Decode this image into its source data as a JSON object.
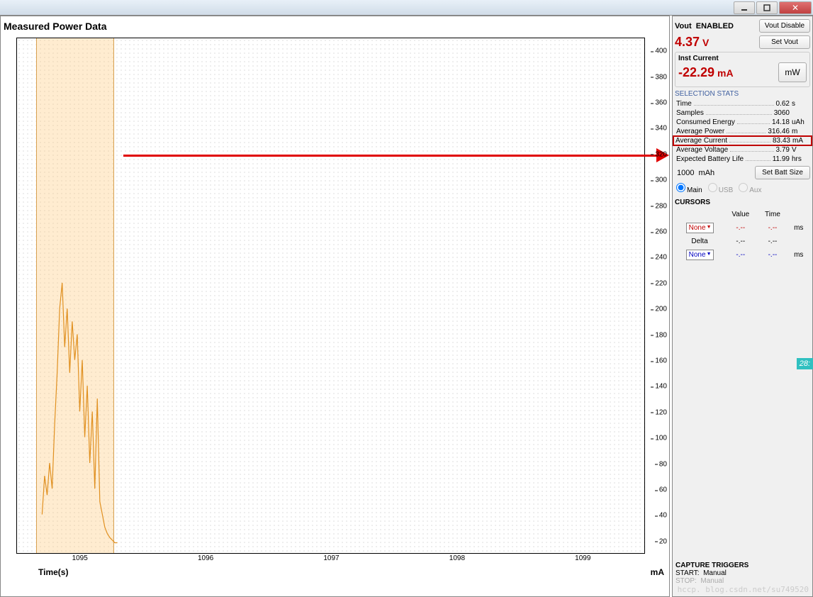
{
  "window": {
    "min_icon": "minimize-icon",
    "max_icon": "maximize-icon",
    "close_icon": "close-icon"
  },
  "chart": {
    "title": "Measured Power Data",
    "xlabel": "Time(s)",
    "yunit": "mA",
    "x_ticks": [
      "1095",
      "1096",
      "1097",
      "1098",
      "1099"
    ],
    "y_ticks": [
      "20",
      "40",
      "60",
      "80",
      "100",
      "120",
      "140",
      "160",
      "180",
      "200",
      "220",
      "240",
      "260",
      "280",
      "300",
      "320",
      "340",
      "360",
      "380",
      "400"
    ]
  },
  "chart_data": {
    "type": "line",
    "xlabel": "Time(s)",
    "ylabel": "mA",
    "xlim": [
      1094.5,
      1099.5
    ],
    "ylim": [
      10,
      410
    ],
    "selection_band_x": [
      1094.65,
      1095.27
    ],
    "annotation_arrow_y": 320,
    "series": [
      {
        "name": "current",
        "color": "#e09020",
        "x": [
          1094.7,
          1094.72,
          1094.74,
          1094.76,
          1094.78,
          1094.8,
          1094.82,
          1094.84,
          1094.86,
          1094.88,
          1094.9,
          1094.92,
          1094.94,
          1094.96,
          1094.98,
          1095.0,
          1095.02,
          1095.04,
          1095.06,
          1095.08,
          1095.1,
          1095.12,
          1095.14,
          1095.16,
          1095.18,
          1095.2,
          1095.22,
          1095.24,
          1095.26,
          1095.28,
          1095.3
        ],
        "values": [
          40,
          70,
          55,
          80,
          60,
          110,
          150,
          200,
          220,
          170,
          200,
          150,
          190,
          160,
          180,
          120,
          160,
          100,
          140,
          80,
          120,
          60,
          130,
          50,
          40,
          30,
          25,
          22,
          20,
          18,
          18
        ]
      }
    ]
  },
  "side": {
    "vout_label": "Vout",
    "vout_status": "ENABLED",
    "vout_disable_btn": "Vout Disable",
    "set_vout_btn": "Set Vout",
    "vout_value": "4.37",
    "vout_unit": "V",
    "inst_label": "Inst Current",
    "inst_value": "-22.29",
    "inst_unit": "mA",
    "mw_btn": "mW",
    "sel_stats_label": "SELECTION STATS",
    "stats": [
      {
        "label": "Time",
        "value": "0.62",
        "unit": "s"
      },
      {
        "label": "Samples",
        "value": "3060",
        "unit": ""
      },
      {
        "label": "Consumed Energy",
        "value": "14.18",
        "unit": "uAh"
      },
      {
        "label": "Average Power",
        "value": "316.46",
        "unit": "m"
      },
      {
        "label": "Average Current",
        "value": "83.43",
        "unit": "mA"
      },
      {
        "label": "Average Voltage",
        "value": "3.79",
        "unit": "V"
      },
      {
        "label": "Expected Battery Life",
        "value": "11.99",
        "unit": "hrs"
      }
    ],
    "batt_input": "1000",
    "batt_unit": "mAh",
    "set_batt_btn": "Set Batt Size",
    "radio_main": "Main",
    "radio_usb": "USB",
    "radio_aux": "Aux",
    "cursors_label": "CURSORS",
    "cursor_col_value": "Value",
    "cursor_col_time": "Time",
    "cursor1": "None",
    "cursor1_val": "-.--",
    "cursor1_time": "-.--",
    "cursor1_unit": "ms",
    "delta_label": "Delta",
    "delta_val": "-.--",
    "delta_time": "-.--",
    "cursor2": "None",
    "cursor2_val": "-.--",
    "cursor2_time": "-.--",
    "cursor2_unit": "ms",
    "capture_triggers": "CAPTURE TRIGGERS",
    "start_label": "START:",
    "start_value": "Manual",
    "stop_label": "STOP:",
    "stop_value": "Manual",
    "teal_flag": "28:"
  },
  "watermark": "hccp. blog.csdn.net/su749520"
}
